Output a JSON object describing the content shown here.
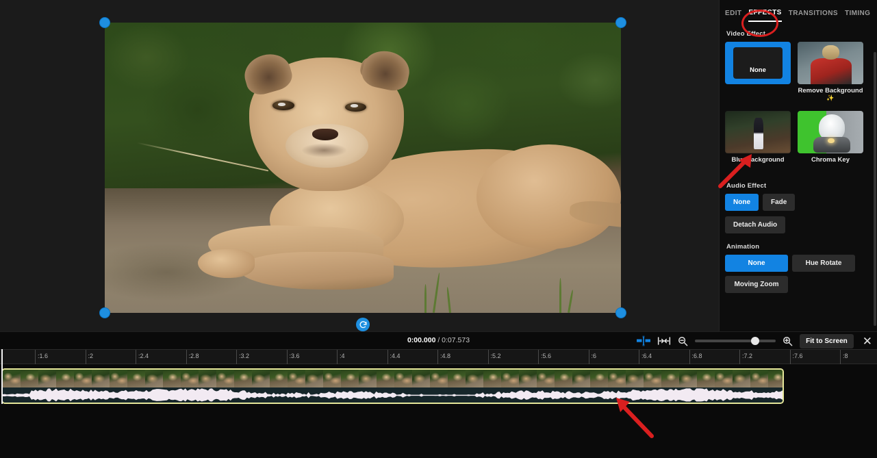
{
  "preview": {
    "name": "video-preview",
    "handles": [
      "top-left",
      "top-right",
      "bottom-left",
      "bottom-right"
    ],
    "rotate_icon": "rotate-icon",
    "drag_dots": "•••"
  },
  "panel": {
    "tabs": [
      {
        "label": "EDIT",
        "active": false
      },
      {
        "label": "EFFECTS",
        "active": true
      },
      {
        "label": "TRANSITIONS",
        "active": false
      },
      {
        "label": "TIMING",
        "active": false
      }
    ],
    "video_effect": {
      "title": "Video Effect",
      "items": [
        {
          "label": "None",
          "selected": true,
          "thumb": "none-thumb"
        },
        {
          "label": "Remove Background",
          "selected": false,
          "thumb": "remove-background-thumb",
          "badge": "✨"
        },
        {
          "label": "Blur Background",
          "selected": false,
          "thumb": "blur-background-thumb"
        },
        {
          "label": "Chroma Key",
          "selected": false,
          "thumb": "chroma-key-thumb"
        }
      ]
    },
    "audio_effect": {
      "title": "Audio Effect",
      "options": [
        {
          "label": "None",
          "active": true
        },
        {
          "label": "Fade",
          "active": false
        }
      ],
      "detach_label": "Detach Audio"
    },
    "animation": {
      "title": "Animation",
      "options": [
        {
          "label": "None",
          "active": true
        },
        {
          "label": "Hue Rotate",
          "active": false
        },
        {
          "label": "Moving Zoom",
          "active": false
        }
      ]
    }
  },
  "transport": {
    "current_time": "0:00.000",
    "separator": " / ",
    "total_time": "0:07.573",
    "tools": {
      "split_icon": "split-clip-icon",
      "fit_icon": "fit-to-clip-icon",
      "zoom_out_icon": "zoom-out-icon",
      "zoom_in_icon": "zoom-in-icon",
      "fit_to_screen_label": "Fit to Screen",
      "close_icon": "close-icon"
    },
    "zoom_value": 70
  },
  "timeline": {
    "ruler_ticks": [
      ":1.6",
      ":2",
      ":2.4",
      ":2.8",
      ":3.2",
      ":3.6",
      ":4",
      ":4.4",
      ":4.8",
      ":5.2",
      ":5.6",
      ":6",
      ":6.4",
      ":6.8",
      ":7.2",
      ":7.6",
      ":8"
    ],
    "clip": {
      "name": "video-clip",
      "selected": true,
      "border_color": "#e6e79a"
    },
    "playhead_position": "0:00.000"
  },
  "annotations": [
    {
      "type": "circle",
      "target": "EFFECTS",
      "color": "#d91f1f"
    },
    {
      "type": "arrow",
      "target": "Blur Background",
      "color": "#d91f1f"
    },
    {
      "type": "arrow",
      "target": "video-clip",
      "color": "#d91f1f"
    }
  ],
  "colors": {
    "accent_blue": "#1283e2",
    "annotation_red": "#d91f1f",
    "clip_border": "#e6e79a",
    "panel_bg": "#0d0d0d"
  }
}
